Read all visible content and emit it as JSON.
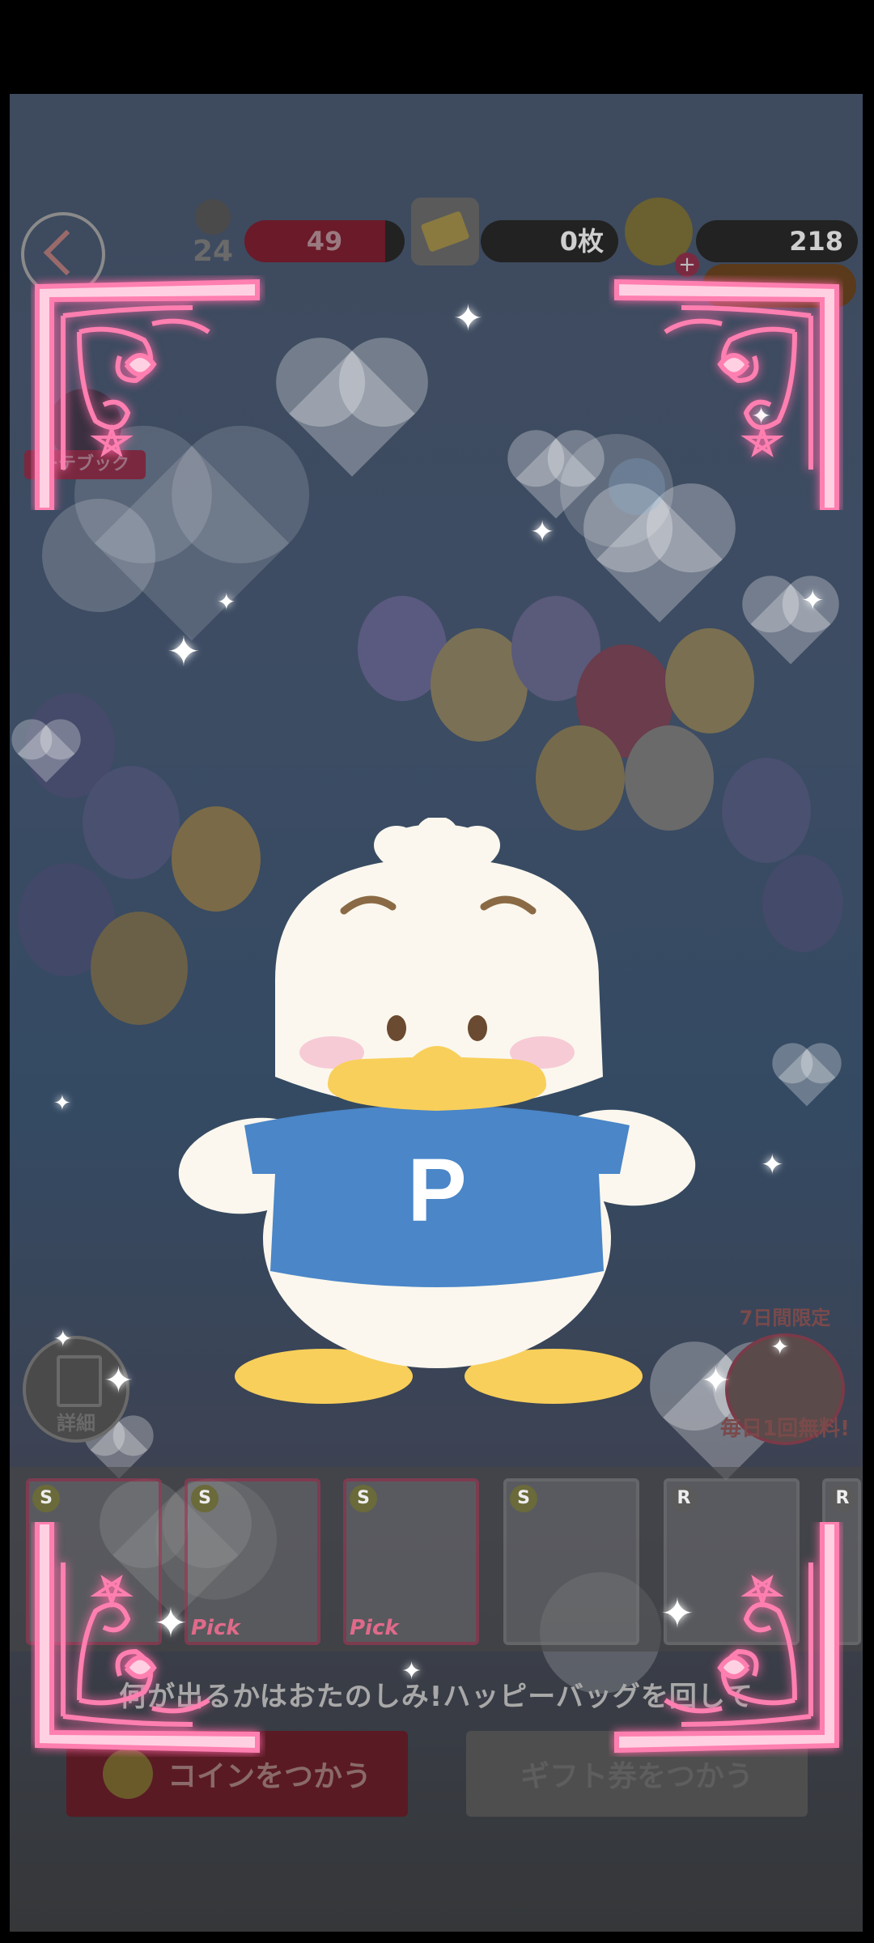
{
  "hud": {
    "level": "24",
    "stamina": "49",
    "tickets": "0枚",
    "coins": "218",
    "notebook_label": "ーテブック",
    "detail_label": "詳細",
    "limited_label": "7日間限定",
    "daily_free_label": "毎日1回無料!"
  },
  "cards": [
    {
      "rarity": "S",
      "tag": ""
    },
    {
      "rarity": "S",
      "tag": "Pick"
    },
    {
      "rarity": "S",
      "tag": "Pick"
    },
    {
      "rarity": "S",
      "tag": ""
    },
    {
      "rarity": "R",
      "tag": ""
    },
    {
      "rarity": "R",
      "tag": ""
    }
  ],
  "banner_text": "何が出るかはおたのしみ!ハッピーバッグを回して",
  "buttons": {
    "use_coins": "コインをつかう",
    "use_gift": "ギフト券をつかう"
  },
  "mascot": {
    "shirt_letter": "P"
  },
  "colors": {
    "frame_pink": "#ff7fb0",
    "shirt_blue": "#4a86c8",
    "beak_yellow": "#f8cf5a"
  }
}
